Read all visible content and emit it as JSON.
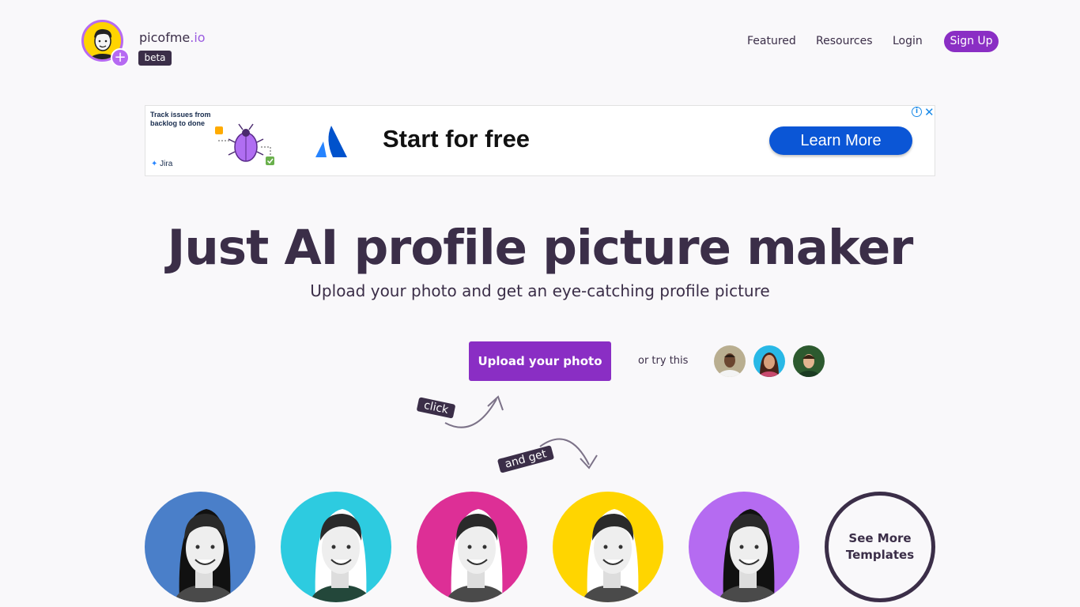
{
  "brand": {
    "name": "picofme",
    "tld": ".io",
    "badge": "beta"
  },
  "nav": {
    "featured": "Featured",
    "resources": "Resources",
    "login": "Login",
    "signup": "Sign Up"
  },
  "ad": {
    "copy": "Track issues from backlog to done",
    "product": "Jira",
    "headline": "Start for free",
    "cta": "Learn More",
    "info_icon": "info-icon",
    "close_icon": "close-icon"
  },
  "hero": {
    "title": "Just AI profile picture maker",
    "subtitle": "Upload your photo and get an eye-catching profile picture",
    "upload_button": "Upload your photo",
    "try_text": "or try this",
    "tag_click": "click",
    "tag_get": "and get"
  },
  "templates": {
    "colors": [
      "#4a7fc9",
      "#2dcbe0",
      "#dd2f96",
      "#ffd500",
      "#b56bf1"
    ],
    "see_more": "See More Templates"
  },
  "colors": {
    "primary": "#8a2ec4",
    "dark": "#3b2e48",
    "accent": "#b66af2"
  }
}
